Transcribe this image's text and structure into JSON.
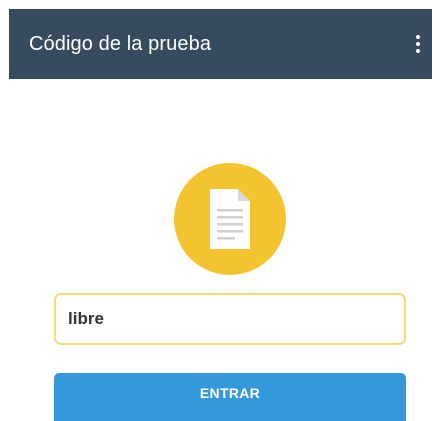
{
  "app_bar": {
    "title": "Código de la prueba",
    "menu_icon": "more-vert-icon"
  },
  "document_icon": {
    "icon": "document-icon",
    "circle_color": "#f4c430"
  },
  "code_field": {
    "value": "libre",
    "border_color": "#f3dd7a"
  },
  "enter_button": {
    "label": "ENTRAR",
    "color": "#3498db"
  },
  "colors": {
    "app_bar_bg": "#374b5e",
    "background": "#ffffff"
  }
}
